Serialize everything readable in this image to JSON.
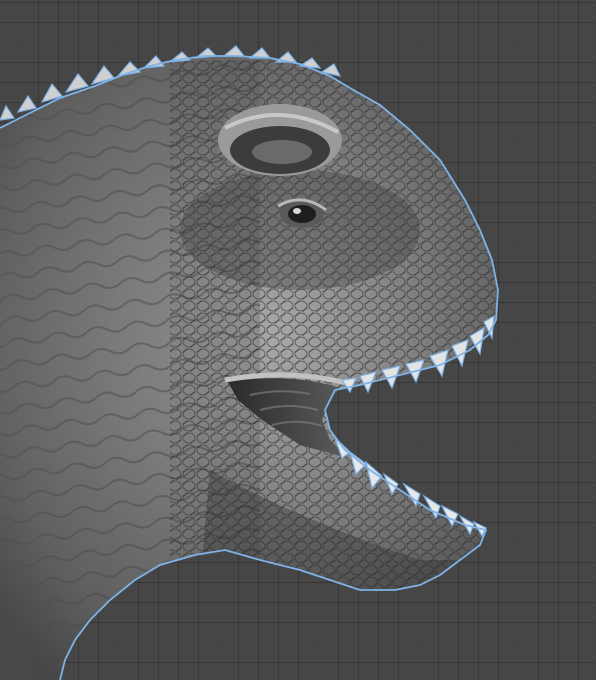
{
  "viewport": {
    "grid_visible": true,
    "background_color": "#464646",
    "selection_outline_color": "#7fb3e8"
  },
  "scene": {
    "object_type": "dinosaur-head-sculpt",
    "selected": true,
    "material": "grayscale-clay"
  }
}
